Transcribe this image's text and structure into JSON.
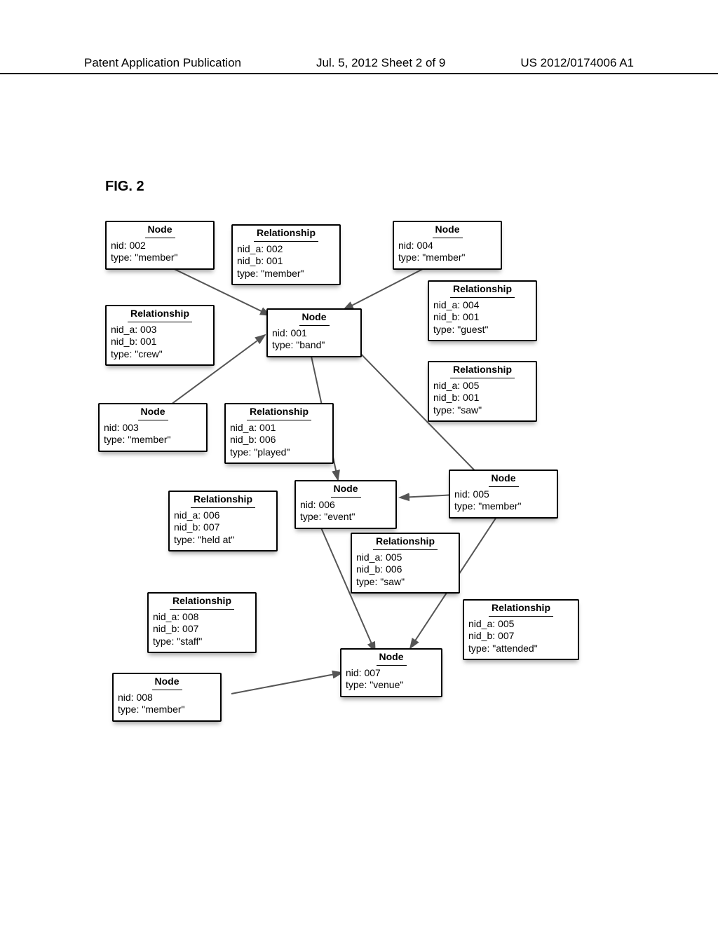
{
  "header": {
    "left": "Patent Application Publication",
    "center": "Jul. 5, 2012   Sheet 2 of 9",
    "right": "US 2012/0174006 A1"
  },
  "figure_label": "FIG. 2",
  "labels": {
    "node": "Node",
    "relationship": "Relationship"
  },
  "nodes": {
    "n002": {
      "nid": "nid: 002",
      "type": "type: \"member\""
    },
    "n004": {
      "nid": "nid: 004",
      "type": "type: \"member\""
    },
    "n001": {
      "nid": "nid: 001",
      "type": "type: \"band\""
    },
    "n003": {
      "nid": "nid: 003",
      "type": "type: \"member\""
    },
    "n005": {
      "nid": "nid: 005",
      "type": "type: \"member\""
    },
    "n006": {
      "nid": "nid: 006",
      "type": "type: \"event\""
    },
    "n007": {
      "nid": "nid: 007",
      "type": "type: \"venue\""
    },
    "n008": {
      "nid": "nid: 008",
      "type": "type: \"member\""
    }
  },
  "relationships": {
    "r002_001": {
      "a": "nid_a: 002",
      "b": "nid_b: 001",
      "type": "type: \"member\""
    },
    "r004_001": {
      "a": "nid_a: 004",
      "b": "nid_b: 001",
      "type": "type: \"guest\""
    },
    "r003_001": {
      "a": "nid_a: 003",
      "b": "nid_b: 001",
      "type": "type: \"crew\""
    },
    "r005_001": {
      "a": "nid_a: 005",
      "b": "nid_b: 001",
      "type": "type: \"saw\""
    },
    "r001_006": {
      "a": "nid_a: 001",
      "b": "nid_b: 006",
      "type": "type: \"played\""
    },
    "r006_007": {
      "a": "nid_a: 006",
      "b": "nid_b: 007",
      "type": "type: \"held at\""
    },
    "r005_006": {
      "a": "nid_a: 005",
      "b": "nid_b: 006",
      "type": "type: \"saw\""
    },
    "r008_007": {
      "a": "nid_a: 008",
      "b": "nid_b: 007",
      "type": "type: \"staff\""
    },
    "r005_007": {
      "a": "nid_a: 005",
      "b": "nid_b: 007",
      "type": "type: \"attended\""
    }
  },
  "chart_data": {
    "type": "graph",
    "nodes": [
      {
        "id": "001",
        "type": "band"
      },
      {
        "id": "002",
        "type": "member"
      },
      {
        "id": "003",
        "type": "member"
      },
      {
        "id": "004",
        "type": "member"
      },
      {
        "id": "005",
        "type": "member"
      },
      {
        "id": "006",
        "type": "event"
      },
      {
        "id": "007",
        "type": "venue"
      },
      {
        "id": "008",
        "type": "member"
      }
    ],
    "edges": [
      {
        "from": "002",
        "to": "001",
        "label": "member"
      },
      {
        "from": "004",
        "to": "001",
        "label": "guest"
      },
      {
        "from": "003",
        "to": "001",
        "label": "crew"
      },
      {
        "from": "005",
        "to": "001",
        "label": "saw"
      },
      {
        "from": "001",
        "to": "006",
        "label": "played"
      },
      {
        "from": "006",
        "to": "007",
        "label": "held at"
      },
      {
        "from": "005",
        "to": "006",
        "label": "saw"
      },
      {
        "from": "008",
        "to": "007",
        "label": "staff"
      },
      {
        "from": "005",
        "to": "007",
        "label": "attended"
      }
    ]
  }
}
